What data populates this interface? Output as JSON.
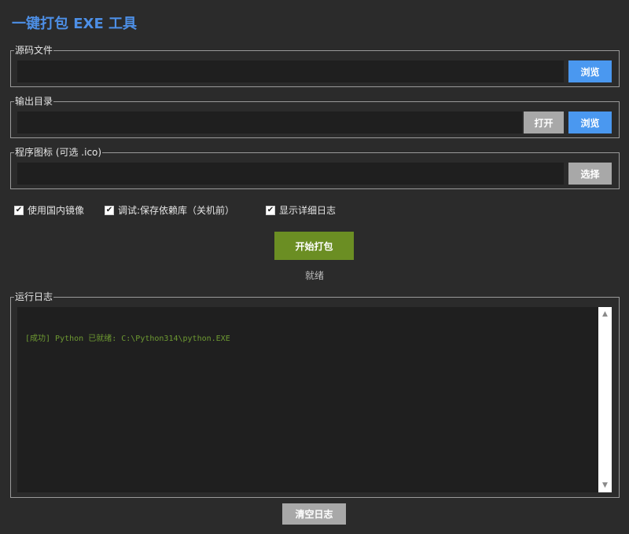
{
  "app": {
    "title": "一键打包 EXE 工具"
  },
  "source": {
    "legend": "源码文件",
    "value": "",
    "browse_label": "浏览"
  },
  "output": {
    "legend": "输出目录",
    "value": "",
    "open_label": "打开",
    "browse_label": "浏览"
  },
  "icon": {
    "legend": "程序图标 (可选 .ico)",
    "value": "",
    "select_label": "选择"
  },
  "options": [
    {
      "label": "使用国内镜像",
      "checked": true
    },
    {
      "label": "调试:保存依赖库（关机前）",
      "checked": true
    },
    {
      "label": "显示详细日志",
      "checked": true
    }
  ],
  "actions": {
    "start_label": "开始打包",
    "status": "就绪",
    "clear_label": "清空日志"
  },
  "log": {
    "legend": "运行日志",
    "lines": [
      "[成功] Python 已就绪: C:\\Python314\\python.EXE"
    ]
  },
  "colors": {
    "accent": "#4d8fe6",
    "primary_button": "#4a98f0",
    "start_button": "#6b8e23",
    "success_text": "#6e9a32"
  }
}
